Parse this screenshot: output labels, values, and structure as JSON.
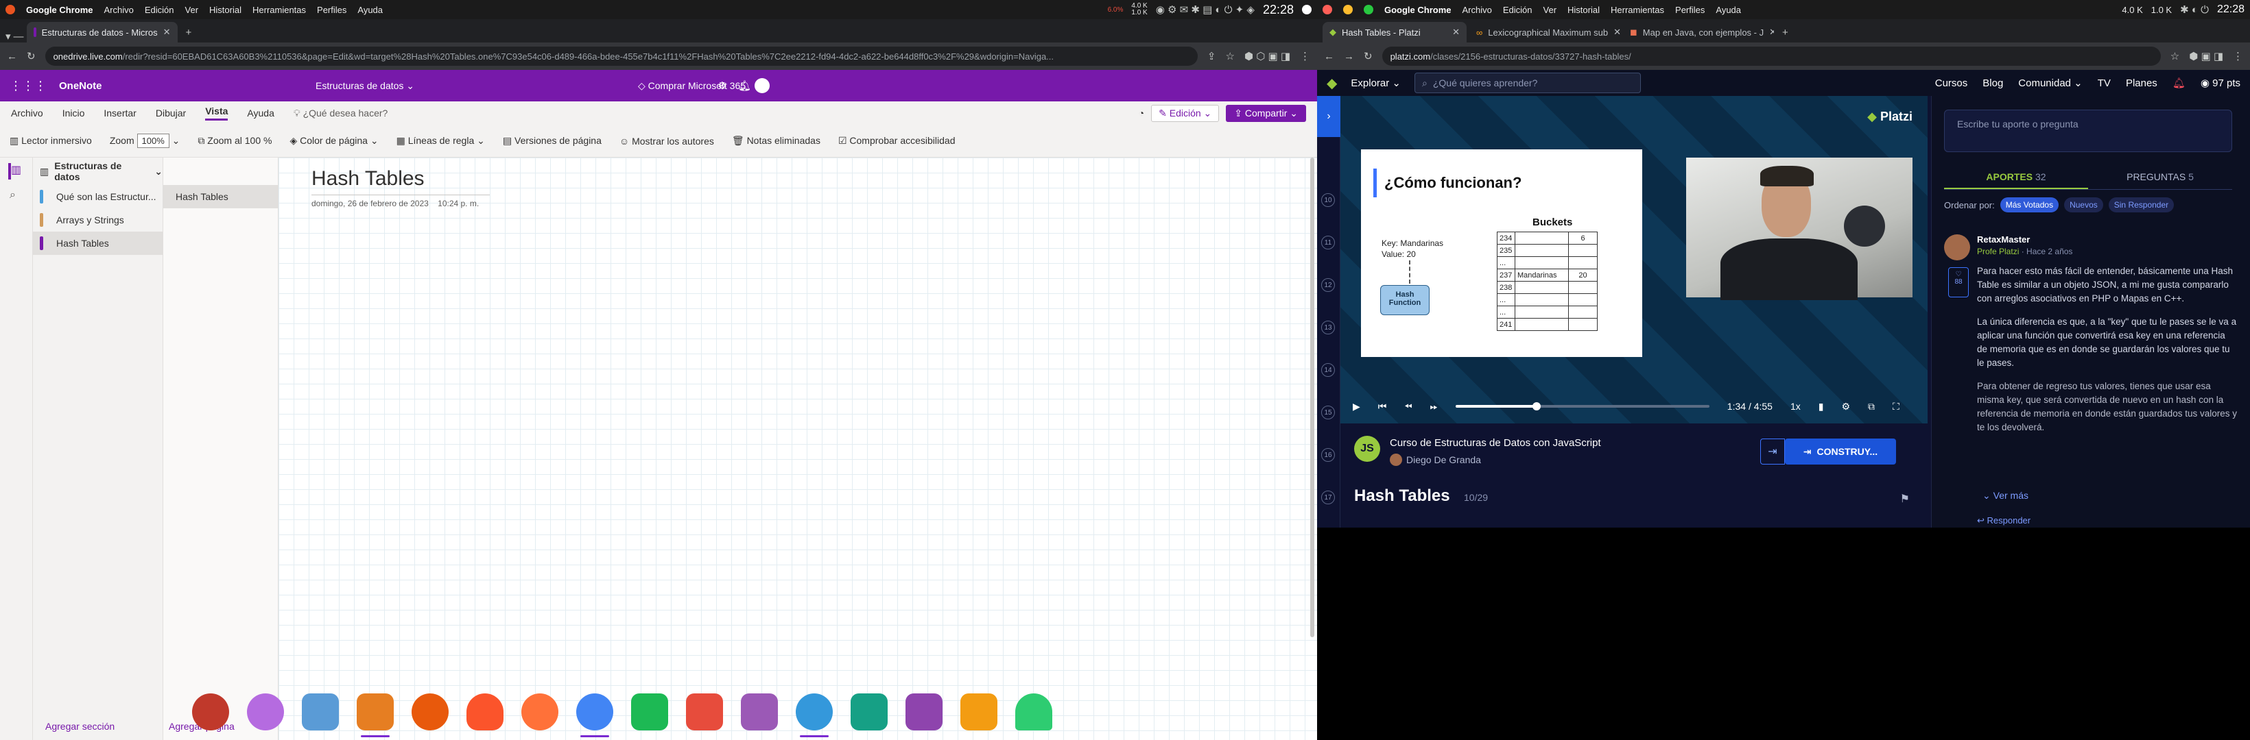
{
  "left": {
    "sys": {
      "app": "Google Chrome",
      "menus": [
        "Archivo",
        "Edición",
        "Ver",
        "Historial",
        "Herramientas",
        "Perfiles",
        "Ayuda"
      ],
      "net_up": "4.0 K",
      "net_down": "1.0 K",
      "time": "22:28",
      "cpu": "6.0%"
    },
    "tab": {
      "title": "Estructuras de datos - Micros"
    },
    "url": {
      "host": "onedrive.live.com",
      "path": "/redir?resid=60EBAD61C63A60B3%2110536&page=Edit&wd=target%28Hash%20Tables.one%7C93e54c06-d489-466a-bdee-455e7b4c1f11%2FHash%20Tables%7C2ee2212-fd94-4dc2-a622-be644d8ff0c3%2F%29&wdorigin=Naviga..."
    },
    "onenote": {
      "app": "OneNote",
      "notebook": "Estructuras de datos",
      "buy": "Comprar Microsoft 365",
      "menu": [
        "Archivo",
        "Inicio",
        "Insertar",
        "Dibujar",
        "Vista",
        "Ayuda"
      ],
      "menu_active": "Vista",
      "help": "¿Qué desea hacer?",
      "edit_btn": "Edición",
      "share_btn": "Compartir",
      "tools": {
        "reader": "Lector inmersivo",
        "zoom_label": "Zoom",
        "zoom_value": "100%",
        "zoom100": "Zoom al 100 %",
        "page_color": "Color de página",
        "rules": "Líneas de regla",
        "versions": "Versiones de página",
        "authors": "Mostrar los autores",
        "deleted": "Notas eliminadas",
        "access": "Comprobar accesibilidad"
      },
      "nb_title": "Estructuras de datos",
      "sections": [
        {
          "label": "Qué son las Estructur...",
          "color": "#4a9fdc"
        },
        {
          "label": "Arrays y Strings",
          "color": "#d19b5c"
        },
        {
          "label": "Hash Tables",
          "color": "#7719aa"
        }
      ],
      "pages": [
        "Hash Tables"
      ],
      "page_title": "Hash Tables",
      "page_date": "domingo, 26 de febrero de 2023",
      "page_time": "10:24 p. m.",
      "add_section": "Agregar sección",
      "add_page": "Agregar página"
    }
  },
  "right": {
    "sys": {
      "app": "Google Chrome",
      "menus": [
        "Archivo",
        "Edición",
        "Ver",
        "Historial",
        "Herramientas",
        "Perfiles",
        "Ayuda"
      ],
      "net_up": "4.0 K",
      "net_down": "1.0 K",
      "time": "22:28"
    },
    "tabs": [
      "Hash Tables - Platzi",
      "Lexicographical Maximum sub",
      "Map en Java, con ejemplos - J"
    ],
    "url": {
      "host": "platzi.com",
      "path": "/clases/2156-estructuras-datos/33727-hash-tables/"
    },
    "platzi": {
      "logo": "Platzi",
      "explore": "Explorar",
      "search": "¿Qué quieres aprender?",
      "nav": [
        "Cursos",
        "Blog",
        "Comunidad",
        "TV",
        "Planes"
      ],
      "points": "97 pts",
      "slide": {
        "title": "¿Cómo funcionan?",
        "buckets": "Buckets",
        "key": "Key: Mandarinas",
        "value": "Value: 20",
        "fn": "Hash Function",
        "rows": [
          [
            "234",
            "",
            "6"
          ],
          [
            "235",
            "",
            ""
          ],
          [
            "...",
            "",
            ""
          ],
          [
            "237",
            "Mandarinas",
            "20"
          ],
          [
            "238",
            "",
            ""
          ],
          [
            "...",
            "",
            ""
          ],
          [
            "...",
            "",
            ""
          ],
          [
            "241",
            "",
            ""
          ]
        ]
      },
      "player": {
        "time": "1:34",
        "sep": "/",
        "total": "4:55",
        "speed": "1x",
        "progress": 0.32
      },
      "course": "Curso de Estructuras de Datos con JavaScript",
      "author": "Diego De Granda",
      "build": "CONSTRUY...",
      "lesson": "Hash Tables",
      "lesson_count": "10/29",
      "lesson_nums": [
        "10",
        "11",
        "12",
        "13",
        "14",
        "15",
        "16",
        "17"
      ],
      "comment_placeholder": "Escribe tu aporte o pregunta",
      "tab_aportes": "APORTES",
      "aportes_count": "32",
      "tab_preguntas": "PREGUNTAS",
      "preguntas_count": "5",
      "sort_label": "Ordenar por:",
      "sort": [
        "Más Votados",
        "Nuevos",
        "Sin Responder"
      ],
      "comment": {
        "user": "RetaxMaster",
        "role": "Profe Platzi",
        "ago": "· Hace 2 años",
        "likes": "88",
        "p1": "Para hacer esto más fácil de entender, básicamente una Hash Table es similar a un objeto JSON, a mi me gusta compararlo con arreglos asociativos en PHP o Mapas en C++.",
        "p2": "La única diferencia es que, a la \"key\" que tu le pases se le va a aplicar una función que convertirá esa key en una referencia de memoria que es en donde se guardarán los valores que tu le pases.",
        "p3": "Para obtener de regreso tus valores, tienes que usar esa misma key, que será convertida de nuevo en un hash con la referencia de memoria en donde están guardados tus valores y te los devolverá."
      },
      "more": "Ver más",
      "reply": "Responder"
    }
  }
}
